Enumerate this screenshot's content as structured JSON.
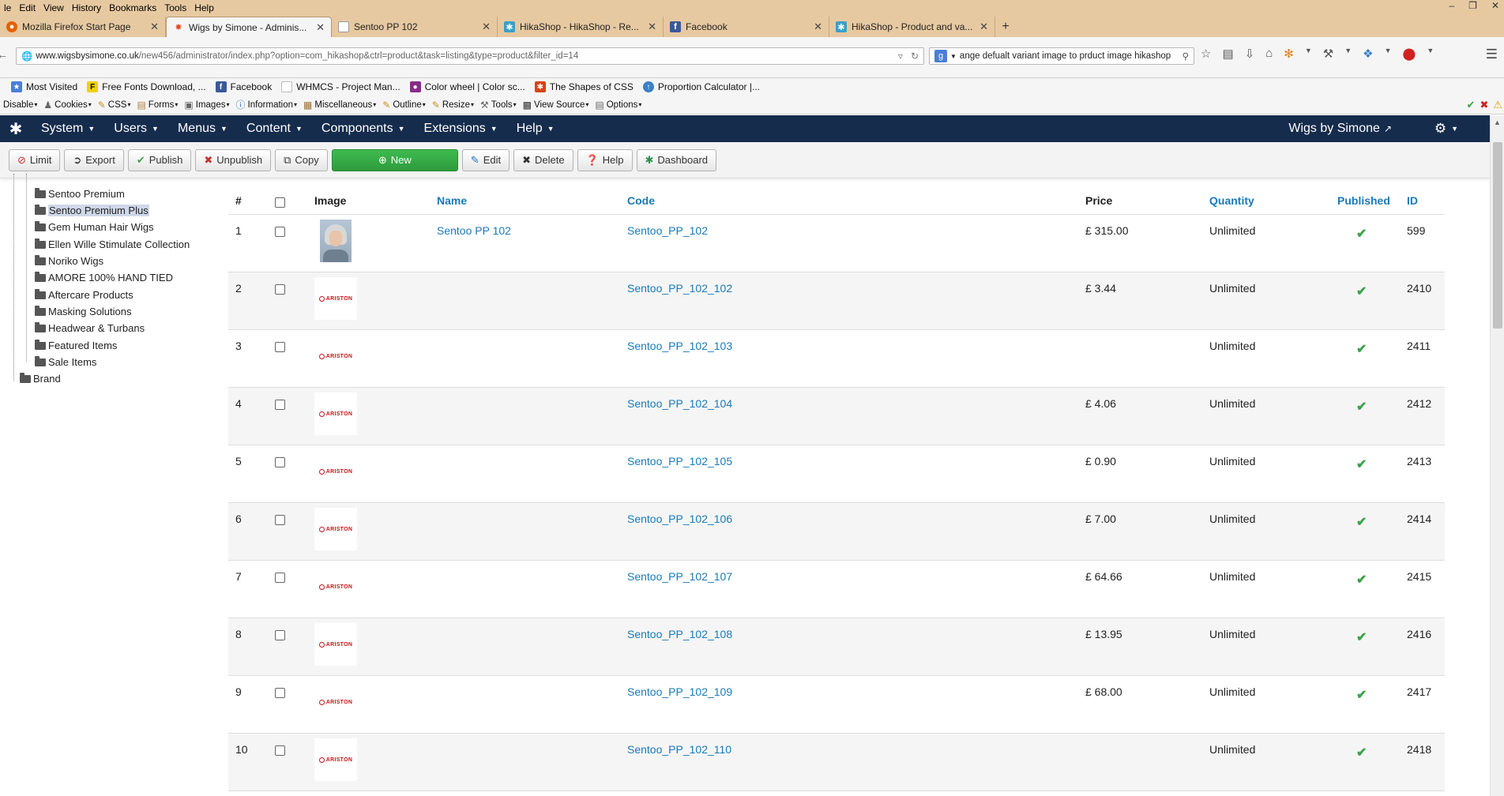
{
  "firefox": {
    "menu": [
      "le",
      "Edit",
      "View",
      "History",
      "Bookmarks",
      "Tools",
      "Help"
    ],
    "window_controls": [
      "–",
      "❐",
      "✕"
    ],
    "tabs": [
      {
        "title": "Mozilla Firefox Start Page",
        "icon": "firefox-icon",
        "active": false
      },
      {
        "title": "Wigs by Simone - Adminis...",
        "icon": "joomla-icon",
        "active": true
      },
      {
        "title": "Sentoo PP 102",
        "icon": "page-icon",
        "active": false
      },
      {
        "title": "HikaShop - HikaShop - Re...",
        "icon": "hikashop-icon",
        "active": false
      },
      {
        "title": "Facebook",
        "icon": "facebook-icon",
        "active": false
      },
      {
        "title": "HikaShop - Product and va...",
        "icon": "hikashop-icon",
        "active": false
      }
    ],
    "url": {
      "host": "www.wigsbysimone.co.uk",
      "path": "/new456/administrator/index.php?option=com_hikashop&ctrl=product&task=listing&type=product&filter_id=14"
    },
    "search_value": "ange defualt variant image to prduct image hikashop",
    "bookmarks": [
      {
        "label": "Most Visited",
        "icon": "star-icon",
        "color": "#4a7ed6"
      },
      {
        "label": "Free Fonts Download, ...",
        "icon": "font-icon",
        "color": "#f0d000"
      },
      {
        "label": "Facebook",
        "icon": "facebook-icon",
        "color": "#3b5998"
      },
      {
        "label": "WHMCS - Project Man...",
        "icon": "page-icon",
        "color": "#ffffff"
      },
      {
        "label": "Color wheel | Color sc...",
        "icon": "color-icon",
        "color": "#8a2b8a"
      },
      {
        "label": "The Shapes of CSS",
        "icon": "css-icon",
        "color": "#d84315"
      },
      {
        "label": "Proportion Calculator |...",
        "icon": "calc-icon",
        "color": "#3a80c8"
      }
    ],
    "webdev": [
      "Disable",
      "Cookies",
      "CSS",
      "Forms",
      "Images",
      "Information",
      "Miscellaneous",
      "Outline",
      "Resize",
      "Tools",
      "View Source",
      "Options"
    ]
  },
  "joomla": {
    "menu": [
      "System",
      "Users",
      "Menus",
      "Content",
      "Components",
      "Extensions",
      "Help"
    ],
    "site_name": "Wigs by Simone",
    "toolbar": {
      "limit": "Limit",
      "export": "Export",
      "publish": "Publish",
      "unpublish": "Unpublish",
      "copy": "Copy",
      "new": "New",
      "edit": "Edit",
      "delete": "Delete",
      "help": "Help",
      "dashboard": "Dashboard"
    }
  },
  "tree": {
    "items": [
      "Sentoo Premium",
      "Sentoo Premium Plus",
      "Gem Human Hair Wigs",
      "Ellen Wille Stimulate Collection",
      "Noriko Wigs",
      "AMORE 100% HAND TIED",
      "Aftercare Products",
      "Masking Solutions",
      "Headwear & Turbans",
      "Featured Items",
      "Sale Items"
    ],
    "root_label": "Brand",
    "selected": "Sentoo Premium Plus"
  },
  "table": {
    "headers": {
      "num": "#",
      "image": "Image",
      "name": "Name",
      "code": "Code",
      "price": "Price",
      "quantity": "Quantity",
      "published": "Published",
      "id": "ID"
    },
    "brand_logo_text": "ARISTON",
    "rows": [
      {
        "num": "1",
        "name": "Sentoo PP 102",
        "code": "Sentoo_PP_102",
        "price": "£ 315.00",
        "quantity": "Unlimited",
        "id": "599",
        "image": "portrait"
      },
      {
        "num": "2",
        "name": "",
        "code": "Sentoo_PP_102_102",
        "price": "£ 3.44",
        "quantity": "Unlimited",
        "id": "2410",
        "image": "ariston"
      },
      {
        "num": "3",
        "name": "",
        "code": "Sentoo_PP_102_103",
        "price": "",
        "quantity": "Unlimited",
        "id": "2411",
        "image": "ariston"
      },
      {
        "num": "4",
        "name": "",
        "code": "Sentoo_PP_102_104",
        "price": "£ 4.06",
        "quantity": "Unlimited",
        "id": "2412",
        "image": "ariston"
      },
      {
        "num": "5",
        "name": "",
        "code": "Sentoo_PP_102_105",
        "price": "£ 0.90",
        "quantity": "Unlimited",
        "id": "2413",
        "image": "ariston"
      },
      {
        "num": "6",
        "name": "",
        "code": "Sentoo_PP_102_106",
        "price": "£ 7.00",
        "quantity": "Unlimited",
        "id": "2414",
        "image": "ariston"
      },
      {
        "num": "7",
        "name": "",
        "code": "Sentoo_PP_102_107",
        "price": "£ 64.66",
        "quantity": "Unlimited",
        "id": "2415",
        "image": "ariston"
      },
      {
        "num": "8",
        "name": "",
        "code": "Sentoo_PP_102_108",
        "price": "£ 13.95",
        "quantity": "Unlimited",
        "id": "2416",
        "image": "ariston"
      },
      {
        "num": "9",
        "name": "",
        "code": "Sentoo_PP_102_109",
        "price": "£ 68.00",
        "quantity": "Unlimited",
        "id": "2417",
        "image": "ariston"
      },
      {
        "num": "10",
        "name": "",
        "code": "Sentoo_PP_102_110",
        "price": "",
        "quantity": "Unlimited",
        "id": "2418",
        "image": "ariston"
      }
    ]
  }
}
